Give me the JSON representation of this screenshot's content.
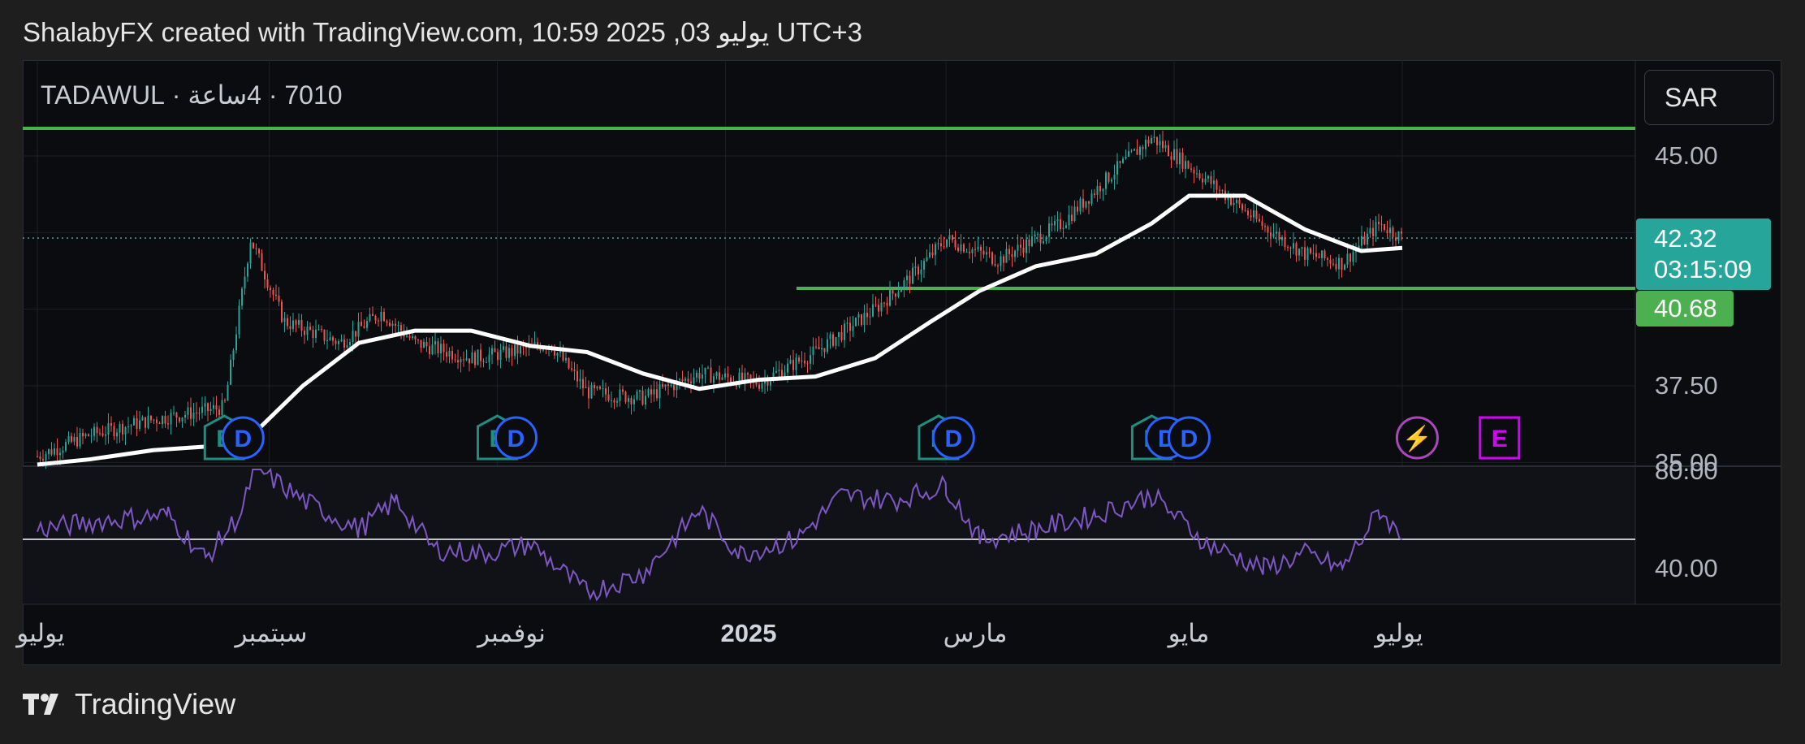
{
  "header": {
    "title": "ShalabyFX created with TradingView.com, 10:59 2025 ,03 يوليو UTC+3"
  },
  "symbol": {
    "text": "7010 · 4ساعة · TADAWUL"
  },
  "currency": {
    "label": "SAR"
  },
  "footer": {
    "brand": "TradingView"
  },
  "colors": {
    "background": "#0b0c0f",
    "up_candle": "#26a69a",
    "down_candle": "#ef5350",
    "moving_average": "#ffffff",
    "support_resistance": "#4caf50",
    "rsi": "#7e57c2",
    "current_price_tag": "#26a69a",
    "earnings_icon": "#1e8e7e",
    "dividend_icon": "#2962ff",
    "split_icon": "#ab47bc"
  },
  "price_tags": {
    "current_price": "42.32",
    "countdown": "03:15:09",
    "support_level": "40.68"
  },
  "chart_data": {
    "type": "candlestick",
    "price_axis": {
      "ticks": [
        "45.00",
        "37.50",
        "35.00"
      ],
      "ylim": [
        35.0,
        45.0
      ]
    },
    "rsi_axis": {
      "ticks": [
        "80.00",
        "40.00"
      ]
    },
    "time_axis": {
      "labels": [
        "يوليو",
        "سبتمبر",
        "نوفمبر",
        "2025",
        "مارس",
        "مايو",
        "يوليو"
      ]
    },
    "horizontal_lines": [
      {
        "name": "resistance",
        "price": 45.9
      },
      {
        "name": "support",
        "price": 40.68
      }
    ],
    "current_price": 42.32,
    "series": [
      {
        "name": "close_trace",
        "points": [
          [
            "2024-07-01",
            35.2
          ],
          [
            "2024-07-15",
            35.9
          ],
          [
            "2024-08-01",
            36.4
          ],
          [
            "2024-08-20",
            36.8
          ],
          [
            "2024-08-27",
            42.3
          ],
          [
            "2024-09-05",
            39.6
          ],
          [
            "2024-09-20",
            38.9
          ],
          [
            "2024-10-01",
            39.9
          ],
          [
            "2024-10-10",
            38.9
          ],
          [
            "2024-10-25",
            38.4
          ],
          [
            "2024-11-05",
            38.6
          ],
          [
            "2024-11-15",
            38.9
          ],
          [
            "2024-11-25",
            37.3
          ],
          [
            "2024-12-10",
            37.1
          ],
          [
            "2024-12-25",
            37.9
          ],
          [
            "2025-01-10",
            37.6
          ],
          [
            "2025-01-25",
            38.6
          ],
          [
            "2025-02-10",
            40.0
          ],
          [
            "2025-02-20",
            41.1
          ],
          [
            "2025-03-01",
            42.3
          ],
          [
            "2025-03-15",
            41.6
          ],
          [
            "2025-04-01",
            42.8
          ],
          [
            "2025-04-15",
            44.5
          ],
          [
            "2025-04-25",
            45.6
          ],
          [
            "2025-05-10",
            44.2
          ],
          [
            "2025-05-25",
            42.7
          ],
          [
            "2025-06-05",
            41.8
          ],
          [
            "2025-06-15",
            41.5
          ],
          [
            "2025-06-25",
            42.8
          ],
          [
            "2025-07-01",
            42.32
          ]
        ]
      },
      {
        "name": "moving_average",
        "points": [
          [
            "2024-07-01",
            34.7
          ],
          [
            "2024-07-15",
            35.1
          ],
          [
            "2024-08-01",
            35.4
          ],
          [
            "2024-08-25",
            35.6
          ],
          [
            "2024-09-10",
            37.5
          ],
          [
            "2024-09-25",
            38.9
          ],
          [
            "2024-10-10",
            39.3
          ],
          [
            "2024-10-25",
            39.3
          ],
          [
            "2024-11-10",
            38.8
          ],
          [
            "2024-11-25",
            38.6
          ],
          [
            "2024-12-10",
            37.9
          ],
          [
            "2024-12-25",
            37.4
          ],
          [
            "2025-01-10",
            37.7
          ],
          [
            "2025-01-25",
            37.8
          ],
          [
            "2025-02-10",
            38.4
          ],
          [
            "2025-02-25",
            39.6
          ],
          [
            "2025-03-10",
            40.6
          ],
          [
            "2025-03-25",
            41.4
          ],
          [
            "2025-04-10",
            41.8
          ],
          [
            "2025-04-25",
            42.8
          ],
          [
            "2025-05-05",
            43.7
          ],
          [
            "2025-05-20",
            43.7
          ],
          [
            "2025-06-05",
            42.6
          ],
          [
            "2025-06-20",
            41.9
          ],
          [
            "2025-07-01",
            42.0
          ]
        ]
      },
      {
        "name": "rsi",
        "points": [
          [
            "2024-07-01",
            56
          ],
          [
            "2024-07-20",
            60
          ],
          [
            "2024-08-05",
            62
          ],
          [
            "2024-08-15",
            44
          ],
          [
            "2024-08-25",
            64
          ],
          [
            "2024-08-28",
            82
          ],
          [
            "2024-09-10",
            68
          ],
          [
            "2024-09-25",
            56
          ],
          [
            "2024-10-05",
            68
          ],
          [
            "2024-10-15",
            48
          ],
          [
            "2024-10-28",
            46
          ],
          [
            "2024-11-10",
            50
          ],
          [
            "2024-11-25",
            30
          ],
          [
            "2024-12-10",
            38
          ],
          [
            "2024-12-25",
            64
          ],
          [
            "2025-01-05",
            46
          ],
          [
            "2025-01-20",
            52
          ],
          [
            "2025-02-01",
            70
          ],
          [
            "2025-02-15",
            68
          ],
          [
            "2025-03-01",
            74
          ],
          [
            "2025-03-10",
            52
          ],
          [
            "2025-03-25",
            56
          ],
          [
            "2025-04-10",
            62
          ],
          [
            "2025-04-25",
            70
          ],
          [
            "2025-05-10",
            50
          ],
          [
            "2025-05-25",
            40
          ],
          [
            "2025-06-05",
            46
          ],
          [
            "2025-06-15",
            40
          ],
          [
            "2025-06-25",
            64
          ],
          [
            "2025-07-01",
            52
          ]
        ]
      }
    ],
    "event_markers": [
      {
        "date": "2024-08-20",
        "type": "earnings",
        "label": "E"
      },
      {
        "date": "2024-08-25",
        "type": "dividend",
        "label": "D"
      },
      {
        "date": "2024-11-01",
        "type": "earnings",
        "label": "E"
      },
      {
        "date": "2024-11-06",
        "type": "dividend",
        "label": "D"
      },
      {
        "date": "2025-02-27",
        "type": "earnings",
        "label": "E"
      },
      {
        "date": "2025-03-03",
        "type": "dividend",
        "label": "D"
      },
      {
        "date": "2025-04-25",
        "type": "earnings",
        "label": "E"
      },
      {
        "date": "2025-04-29",
        "type": "dividend",
        "label": "D"
      },
      {
        "date": "2025-05-05",
        "type": "dividend",
        "label": "D"
      },
      {
        "date": "2025-07-05",
        "type": "split",
        "label": "⚡"
      },
      {
        "date": "2025-07-27",
        "type": "earnings",
        "label": "E"
      }
    ]
  }
}
